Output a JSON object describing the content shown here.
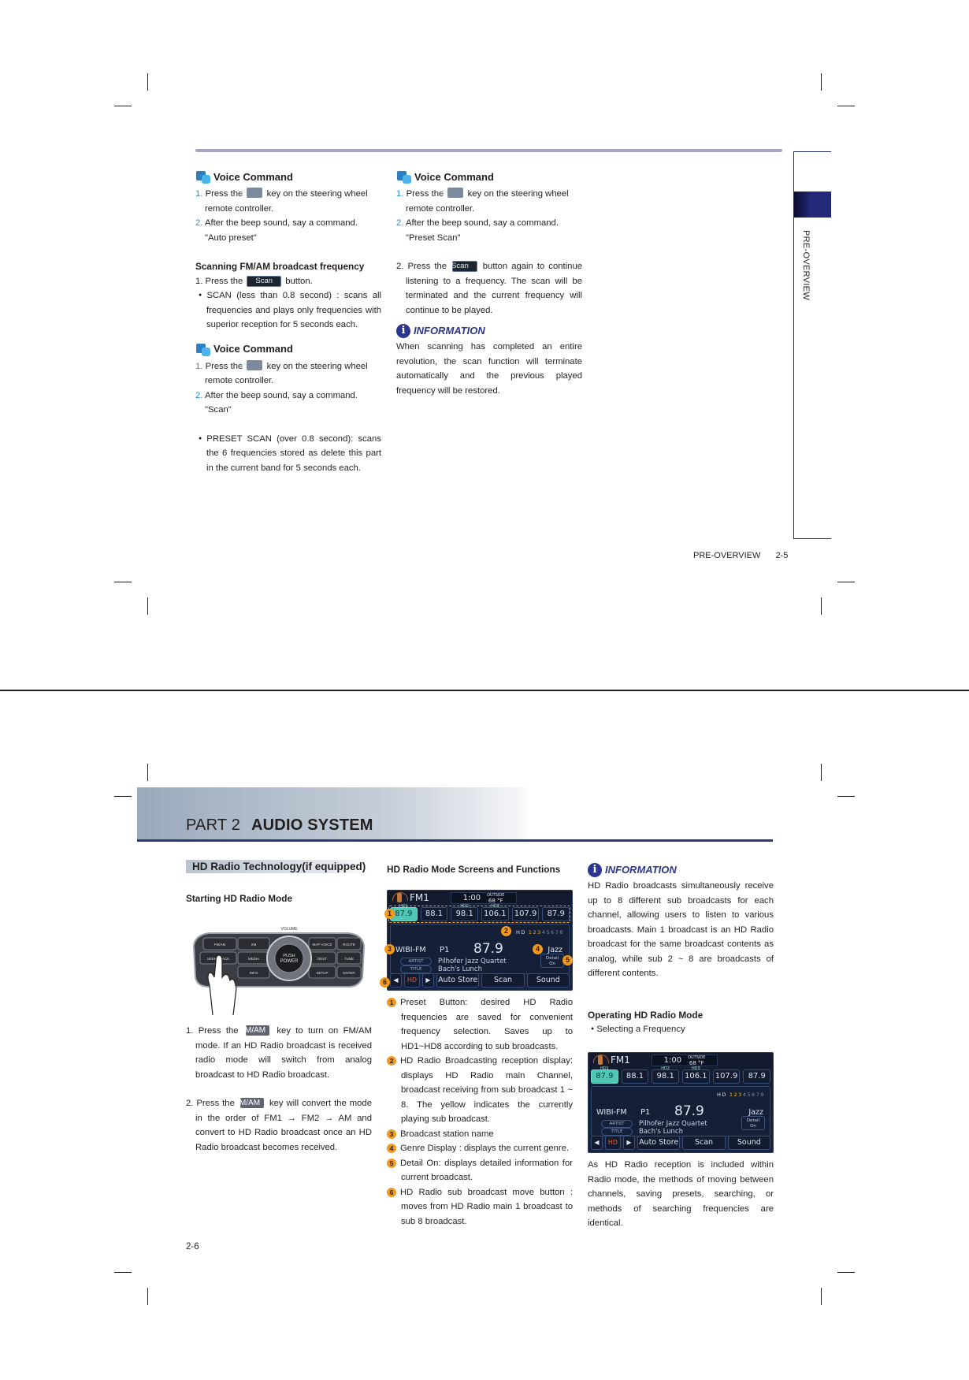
{
  "page1": {
    "side_tab_label": "PRE-OVERVIEW",
    "footer": {
      "section": "PRE-OVERVIEW",
      "page": "2-5"
    },
    "left_col": {
      "vc1": {
        "title": "Voice Command",
        "step1_num": "1.",
        "step1_pre": "Press the",
        "step1_post": "key on the steering wheel remote controller.",
        "step2_num": "2.",
        "step2": "After the beep sound, say a command.",
        "command": "\"Auto preset\""
      },
      "scan_heading": "Scanning FM/AM broadcast frequency",
      "scan_step_pre": "1. Press the",
      "scan_chip": "Scan",
      "scan_step_post": "button.",
      "scan_bullet": "SCAN (less than 0.8 second) : scans all frequencies and plays only frequencies with superior reception for 5 seconds each.",
      "vc2": {
        "title": "Voice Command",
        "step1_num": "1.",
        "step1_pre": "Press the",
        "step1_post": "key on the steering wheel remote controller.",
        "step2_num": "2.",
        "step2": "After the beep sound, say a command.",
        "command": "\"Scan\""
      },
      "preset_bullet": "PRESET SCAN (over 0.8 second):  scans the 6 frequencies stored as delete this part in the current band for 5 seconds each."
    },
    "right_col": {
      "vc3": {
        "title": "Voice Command",
        "step1_num": "1.",
        "step1_pre": "Press the",
        "step1_post": "key on the steering wheel remote controller.",
        "step2_num": "2.",
        "step2": "After the beep sound, say a command.",
        "command": "\"Preset Scan\""
      },
      "step2_pre": "2. Press the",
      "scan_chip": "Scan",
      "step2_post": "button again to continue listening to a frequency. The scan will be terminated and the current frequency will continue to be played.",
      "info_title": "INFORMATION",
      "info_text": "When scanning has completed an entire revolution, the scan function will terminate automatically and the previous played frequency will be restored."
    }
  },
  "page2": {
    "part_label": "PART 2",
    "part_title": "AUDIO SYSTEM",
    "section_title": "HD Radio Technology(if equipped)",
    "col1": {
      "heading": "Starting HD Radio Mode",
      "control_panel": {
        "labels": [
          "VOLUME",
          "FM/AM",
          "XM",
          "MAP VOICE",
          "ROUTE",
          "SEEK TRACK",
          "MEDIA",
          "PUSH POWER",
          "DEST",
          "TUNE",
          "INFO",
          "SETUP",
          "ENTER"
        ]
      },
      "step1_pre": "1. Press the",
      "fmam_chip": "FM/AM",
      "step1_post": "key to turn on FM/AM mode. If an HD Radio broadcast is received radio mode will switch from analog broadcast to HD Radio broadcast.",
      "step2_pre": "2. Press the",
      "step2_post": "key will convert the mode in the order of FM1 → FM2 → AM and convert to HD Radio broadcast once an HD Radio broadcast becomes received."
    },
    "col2": {
      "heading": "HD Radio Mode Screens and Functions",
      "items": [
        {
          "n": "1",
          "text": "Preset Button: desired HD Radio frequencies are saved for convenient frequency selection. Saves up to HD1~HD8 according to sub broadcasts."
        },
        {
          "n": "2",
          "text": "HD Radio Broadcasting reception display: displays HD Radio main Channel, broadcast receiving from sub broadcast 1 ~ 8. The yellow indicates the currently playing sub broadcast."
        },
        {
          "n": "3",
          "text": "Broadcast station name"
        },
        {
          "n": "4",
          "text": "Genre Display : displays the current genre."
        },
        {
          "n": "5",
          "text": "Detail On: displays detailed information for current broadcast."
        },
        {
          "n": "6",
          "text": "HD Radio sub broadcast move button : moves from HD Radio main 1 broadcast to sub 8 broadcast."
        }
      ]
    },
    "col3": {
      "info_title": "INFORMATION",
      "info_text": "HD Radio broadcasts simultaneously receive up to 8 different sub broadcasts for each channel, allowing users to listen to various broadcasts. Main 1 broadcast is an HD Radio broadcast for the same broadcast contents as analog, while sub 2 ~ 8 are broadcasts of different contents.",
      "heading": "Operating HD Radio Mode",
      "bullet": "Selecting a Frequency",
      "closing": "As HD Radio reception is included within Radio mode, the methods of moving between channels, saving presets, searching, or methods of searching frequencies are identical."
    },
    "page_number": "2-6",
    "hd_screen": {
      "band": "FM1",
      "clock": "1:00",
      "outside_label": "OUTSIDE",
      "outside_temp": "68 °F",
      "presets": [
        {
          "label": "87.9",
          "sub": "HD1",
          "active": true
        },
        {
          "label": "88.1",
          "sub": "",
          "active": false
        },
        {
          "label": "98.1",
          "sub": "HD2",
          "active": false
        },
        {
          "label": "106.1",
          "sub": "HD3",
          "active": false
        },
        {
          "label": "107.9",
          "sub": "",
          "active": false
        },
        {
          "label": "87.9",
          "sub": "",
          "active": false
        }
      ],
      "hd_label": "HD",
      "sub_channels": [
        "1",
        "2",
        "3",
        "4",
        "5",
        "6",
        "7",
        "8"
      ],
      "sub_channels_lit": 3,
      "station": "WIBI-FM",
      "preset_num": "P1",
      "frequency": "87.9",
      "genre": "Jazz",
      "artist_label": "ARTIST",
      "artist": "Pilhofer Jazz Quartet",
      "title_label": "TITLE",
      "title": "Bach's Lunch",
      "detail_label_1": "Detail",
      "detail_label_2": "On",
      "btn_prev": "◀",
      "btn_hd": "HD",
      "btn_next": "▶",
      "btn_autostore": "Auto Store",
      "btn_scan": "Scan",
      "btn_sound": "Sound"
    },
    "callouts": [
      "1",
      "2",
      "3",
      "4",
      "5",
      "6"
    ]
  },
  "colors": {
    "accent_blue": "#2b3690",
    "step_blue": "#2d8bd0",
    "callout_orange": "#f29a1f",
    "preset_active": "#50c7b5",
    "rule_lavender": "#a7a6cf"
  }
}
